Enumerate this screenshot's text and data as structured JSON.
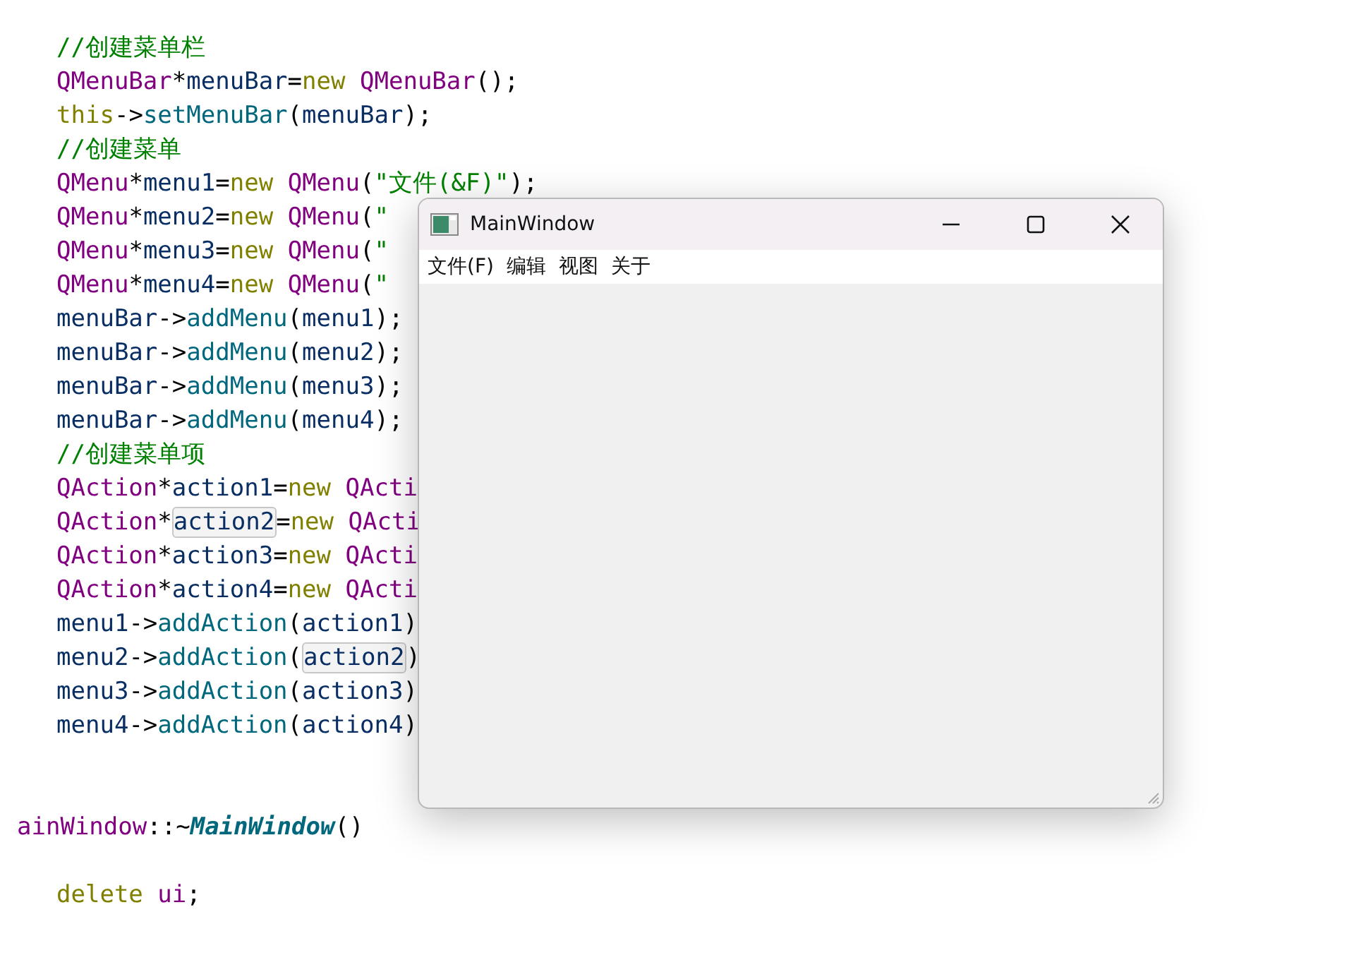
{
  "code_lines": [
    {
      "kind": "code",
      "tokens": [
        {
          "kind": "comment",
          "text": "//创建菜单栏"
        }
      ]
    },
    {
      "kind": "code",
      "tokens": [
        {
          "kind": "type",
          "text": "QMenuBar"
        },
        {
          "kind": "punct",
          "text": "*"
        },
        {
          "kind": "var",
          "text": "menuBar"
        },
        {
          "kind": "punct",
          "text": "="
        },
        {
          "kind": "keyword",
          "text": "new"
        },
        {
          "kind": "space"
        },
        {
          "kind": "type",
          "text": "QMenuBar"
        },
        {
          "kind": "punct",
          "text": "();"
        }
      ]
    },
    {
      "kind": "code",
      "tokens": [
        {
          "kind": "keyword",
          "text": "this"
        },
        {
          "kind": "punct",
          "text": "->"
        },
        {
          "kind": "func",
          "text": "setMenuBar"
        },
        {
          "kind": "punct",
          "text": "("
        },
        {
          "kind": "var",
          "text": "menuBar"
        },
        {
          "kind": "punct",
          "text": ");"
        }
      ]
    },
    {
      "kind": "code",
      "tokens": [
        {
          "kind": "comment",
          "text": "//创建菜单"
        }
      ]
    },
    {
      "kind": "code",
      "tokens": [
        {
          "kind": "type",
          "text": "QMenu"
        },
        {
          "kind": "punct",
          "text": "*"
        },
        {
          "kind": "var",
          "text": "menu1"
        },
        {
          "kind": "punct",
          "text": "="
        },
        {
          "kind": "keyword",
          "text": "new"
        },
        {
          "kind": "space"
        },
        {
          "kind": "type",
          "text": "QMenu"
        },
        {
          "kind": "punct",
          "text": "("
        },
        {
          "kind": "string",
          "text": "\"文件(&F)\""
        },
        {
          "kind": "punct",
          "text": ");"
        }
      ]
    },
    {
      "kind": "code",
      "tokens": [
        {
          "kind": "type",
          "text": "QMenu"
        },
        {
          "kind": "punct",
          "text": "*"
        },
        {
          "kind": "var",
          "text": "menu2"
        },
        {
          "kind": "punct",
          "text": "="
        },
        {
          "kind": "keyword",
          "text": "new"
        },
        {
          "kind": "space"
        },
        {
          "kind": "type",
          "text": "QMenu"
        },
        {
          "kind": "punct",
          "text": "("
        },
        {
          "kind": "string",
          "text": "\""
        }
      ]
    },
    {
      "kind": "code",
      "tokens": [
        {
          "kind": "type",
          "text": "QMenu"
        },
        {
          "kind": "punct",
          "text": "*"
        },
        {
          "kind": "var",
          "text": "menu3"
        },
        {
          "kind": "punct",
          "text": "="
        },
        {
          "kind": "keyword",
          "text": "new"
        },
        {
          "kind": "space"
        },
        {
          "kind": "type",
          "text": "QMenu"
        },
        {
          "kind": "punct",
          "text": "("
        },
        {
          "kind": "string",
          "text": "\""
        }
      ]
    },
    {
      "kind": "code",
      "tokens": [
        {
          "kind": "type",
          "text": "QMenu"
        },
        {
          "kind": "punct",
          "text": "*"
        },
        {
          "kind": "var",
          "text": "menu4"
        },
        {
          "kind": "punct",
          "text": "="
        },
        {
          "kind": "keyword",
          "text": "new"
        },
        {
          "kind": "space"
        },
        {
          "kind": "type",
          "text": "QMenu"
        },
        {
          "kind": "punct",
          "text": "("
        },
        {
          "kind": "string",
          "text": "\""
        }
      ]
    },
    {
      "kind": "code",
      "tokens": [
        {
          "kind": "var",
          "text": "menuBar"
        },
        {
          "kind": "punct",
          "text": "->"
        },
        {
          "kind": "func",
          "text": "addMenu"
        },
        {
          "kind": "punct",
          "text": "("
        },
        {
          "kind": "var",
          "text": "menu1"
        },
        {
          "kind": "punct",
          "text": ");"
        }
      ]
    },
    {
      "kind": "code",
      "tokens": [
        {
          "kind": "var",
          "text": "menuBar"
        },
        {
          "kind": "punct",
          "text": "->"
        },
        {
          "kind": "func",
          "text": "addMenu"
        },
        {
          "kind": "punct",
          "text": "("
        },
        {
          "kind": "var",
          "text": "menu2"
        },
        {
          "kind": "punct",
          "text": ");"
        }
      ]
    },
    {
      "kind": "code",
      "tokens": [
        {
          "kind": "var",
          "text": "menuBar"
        },
        {
          "kind": "punct",
          "text": "->"
        },
        {
          "kind": "func",
          "text": "addMenu"
        },
        {
          "kind": "punct",
          "text": "("
        },
        {
          "kind": "var",
          "text": "menu3"
        },
        {
          "kind": "punct",
          "text": ");"
        }
      ]
    },
    {
      "kind": "code",
      "tokens": [
        {
          "kind": "var",
          "text": "menuBar"
        },
        {
          "kind": "punct",
          "text": "->"
        },
        {
          "kind": "func",
          "text": "addMenu"
        },
        {
          "kind": "punct",
          "text": "("
        },
        {
          "kind": "var",
          "text": "menu4"
        },
        {
          "kind": "punct",
          "text": ");"
        }
      ]
    },
    {
      "kind": "code",
      "tokens": [
        {
          "kind": "comment",
          "text": "//创建菜单项"
        }
      ]
    },
    {
      "kind": "code",
      "tokens": [
        {
          "kind": "type",
          "text": "QAction"
        },
        {
          "kind": "punct",
          "text": "*"
        },
        {
          "kind": "var",
          "text": "action1"
        },
        {
          "kind": "punct",
          "text": "="
        },
        {
          "kind": "keyword",
          "text": "new"
        },
        {
          "kind": "space"
        },
        {
          "kind": "type",
          "text": "QActi"
        }
      ]
    },
    {
      "kind": "code",
      "tokens": [
        {
          "kind": "type",
          "text": "QAction"
        },
        {
          "kind": "punct",
          "text": "*"
        },
        {
          "kind": "ref",
          "text": "action2"
        },
        {
          "kind": "punct",
          "text": "="
        },
        {
          "kind": "keyword",
          "text": "new"
        },
        {
          "kind": "space"
        },
        {
          "kind": "type",
          "text": "QActi"
        }
      ]
    },
    {
      "kind": "code",
      "tokens": [
        {
          "kind": "type",
          "text": "QAction"
        },
        {
          "kind": "punct",
          "text": "*"
        },
        {
          "kind": "var",
          "text": "action3"
        },
        {
          "kind": "punct",
          "text": "="
        },
        {
          "kind": "keyword",
          "text": "new"
        },
        {
          "kind": "space"
        },
        {
          "kind": "type",
          "text": "QActi"
        }
      ]
    },
    {
      "kind": "code",
      "tokens": [
        {
          "kind": "type",
          "text": "QAction"
        },
        {
          "kind": "punct",
          "text": "*"
        },
        {
          "kind": "var",
          "text": "action4"
        },
        {
          "kind": "punct",
          "text": "="
        },
        {
          "kind": "keyword",
          "text": "new"
        },
        {
          "kind": "space"
        },
        {
          "kind": "type",
          "text": "QActi"
        }
      ]
    },
    {
      "kind": "code",
      "tokens": [
        {
          "kind": "var",
          "text": "menu1"
        },
        {
          "kind": "punct",
          "text": "->"
        },
        {
          "kind": "func",
          "text": "addAction"
        },
        {
          "kind": "punct",
          "text": "("
        },
        {
          "kind": "var",
          "text": "action1"
        },
        {
          "kind": "punct",
          "text": ")"
        }
      ]
    },
    {
      "kind": "code",
      "tokens": [
        {
          "kind": "var",
          "text": "menu2"
        },
        {
          "kind": "punct",
          "text": "->"
        },
        {
          "kind": "func",
          "text": "addAction"
        },
        {
          "kind": "punct",
          "text": "("
        },
        {
          "kind": "ref",
          "text": "action2"
        },
        {
          "kind": "punct",
          "text": ")"
        }
      ]
    },
    {
      "kind": "code",
      "tokens": [
        {
          "kind": "var",
          "text": "menu3"
        },
        {
          "kind": "punct",
          "text": "->"
        },
        {
          "kind": "func",
          "text": "addAction"
        },
        {
          "kind": "punct",
          "text": "("
        },
        {
          "kind": "var",
          "text": "action3"
        },
        {
          "kind": "punct",
          "text": ")"
        }
      ]
    },
    {
      "kind": "code",
      "tokens": [
        {
          "kind": "var",
          "text": "menu4"
        },
        {
          "kind": "punct",
          "text": "->"
        },
        {
          "kind": "func",
          "text": "addAction"
        },
        {
          "kind": "punct",
          "text": "("
        },
        {
          "kind": "var",
          "text": "action4"
        },
        {
          "kind": "punct",
          "text": ")"
        }
      ]
    },
    {
      "kind": "blank"
    },
    {
      "kind": "blank"
    },
    {
      "kind": "signature",
      "tokens": [
        {
          "kind": "type",
          "text": "ainWindow"
        },
        {
          "kind": "punct",
          "text": "::~"
        },
        {
          "kind": "decl",
          "text": "MainWindow"
        },
        {
          "kind": "punct",
          "text": "()"
        }
      ]
    },
    {
      "kind": "blank"
    },
    {
      "kind": "code",
      "tokens": [
        {
          "kind": "keyword",
          "text": "delete"
        },
        {
          "kind": "space"
        },
        {
          "kind": "type",
          "text": "ui"
        },
        {
          "kind": "punct",
          "text": ";"
        }
      ]
    }
  ],
  "window": {
    "title": "MainWindow",
    "menu_items": [
      "文件(F)",
      "编辑",
      "视图",
      "关于"
    ]
  }
}
